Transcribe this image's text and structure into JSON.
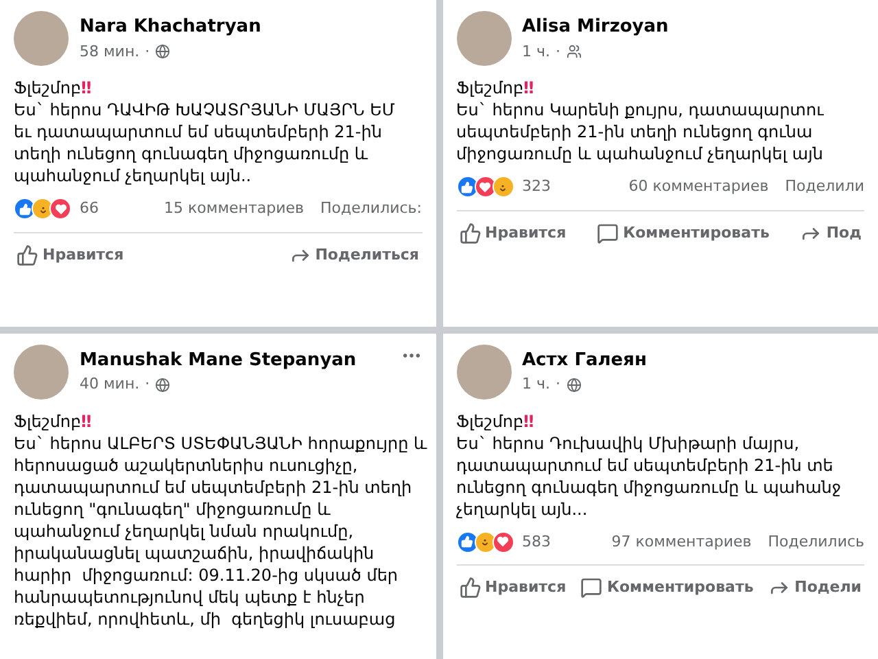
{
  "posts": [
    {
      "author": "Nara Khachatryan",
      "time": "58 мин.",
      "separator": "·",
      "audience": {
        "kind": "public"
      },
      "heading": {
        "text": "Ֆլեշմոբ",
        "mark": "‼"
      },
      "lines": [
        "Ես` հերոս ԴԱՎԻԹ ԽԱՉԱՏՐՅԱՆԻ ՄԱՅՐՆ ԵՄ",
        "եւ դատապարտում եմ սեպտեմբերի 21-ին",
        "տեղի ունեցող գունագեղ միջոցառումը և",
        "պահանջում չեղարկել այն.."
      ],
      "reactions": [
        {
          "kind": "like"
        },
        {
          "kind": "care"
        },
        {
          "kind": "love"
        }
      ],
      "reaction_count": "66",
      "comments": "15 комментариев",
      "shares": "Поделились:",
      "actions": [
        {
          "kind": "like",
          "label": "Нравится"
        },
        {
          "kind": "share",
          "label": "Поделиться"
        }
      ]
    },
    {
      "author": "Alisa Mirzoyan",
      "time": "1 ч.",
      "separator": "·",
      "audience": {
        "kind": "friends"
      },
      "heading": {
        "text": "Ֆլեշմոբ",
        "mark": "‼"
      },
      "lines": [
        "Ես` հերոս Կարենի քույրս, դատապարտու",
        "սեպտեմբերի 21-ին տեղի ունեցող գունա",
        "միջոցառումը և պահանջում չեղարկել այն"
      ],
      "reactions": [
        {
          "kind": "like"
        },
        {
          "kind": "love"
        },
        {
          "kind": "care"
        }
      ],
      "reaction_count": "323",
      "comments": "60 комментариев",
      "shares": "Поделили",
      "actions": [
        {
          "kind": "like",
          "label": "Нравится"
        },
        {
          "kind": "comment",
          "label": "Комментировать"
        },
        {
          "kind": "share",
          "label": "Под"
        }
      ]
    },
    {
      "author": "Manushak Mane Stepanyan",
      "time": "40 мин.",
      "separator": "·",
      "audience": {
        "kind": "public"
      },
      "more_menu": true,
      "heading": {
        "text": "Ֆլեշմոբ",
        "mark": "‼"
      },
      "lines": [
        "Ես` հերոս ԱԼԲԵՐՏ ՍՏԵՓԱՆՅԱՆԻ հորաքույրը և",
        "հերոսացած աշակերտներիս ուսուցիչը,",
        "դատապարտում եմ սեպտեմբերի 21-ին տեղի",
        "ունեցող \"գունագեղ\" միջոցառումը և",
        "պահանջում չեղարկել նման որակումը,",
        "իրականացնել պատշաճին, իրավիճակին",
        "հարիր  միջոցառում: 09.11.20-ից սկսած մեր",
        "հանրապետությունով մեկ պետք է հնչեր",
        "ռեքվիեմ, որովհետև, մի  գեղեցիկ լուսաբաց"
      ]
    },
    {
      "author": "Астх Галеян",
      "time": "1 ч.",
      "separator": "·",
      "audience": {
        "kind": "public"
      },
      "heading": {
        "text": "Ֆլեշմոբ",
        "mark": "‼"
      },
      "lines": [
        "Ես` հերոս Դուխավիկ Մխիթարի մայրս,",
        "դատապարտում եմ սեպտեմբերի 21-ին տե",
        "ունեցող գունագեղ միջոցառումը և պահանջ",
        "չեղարկել այն..."
      ],
      "reactions": [
        {
          "kind": "like"
        },
        {
          "kind": "care"
        },
        {
          "kind": "love"
        }
      ],
      "reaction_count": "583",
      "comments": "97 комментариев",
      "shares": "Поделились",
      "actions": [
        {
          "kind": "like",
          "label": "Нравится"
        },
        {
          "kind": "comment",
          "label": "Комментировать"
        },
        {
          "kind": "share",
          "label": "Подели"
        }
      ]
    }
  ]
}
